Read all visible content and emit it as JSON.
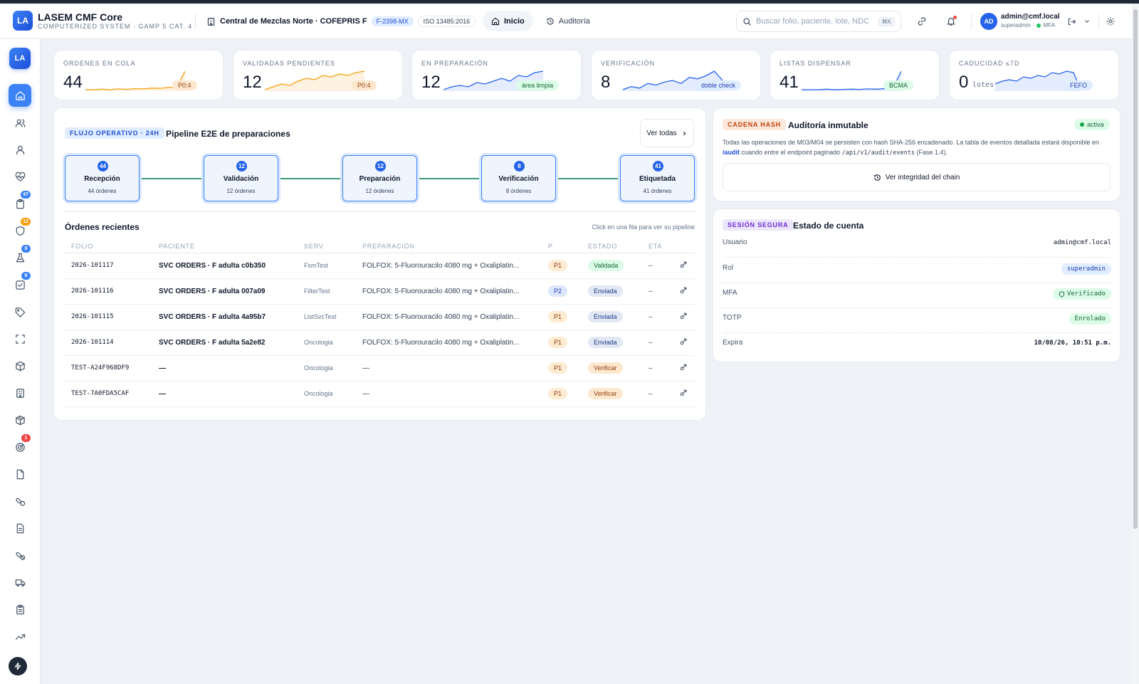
{
  "header": {
    "logo_text": "LA",
    "title": "LASEM CMF Core",
    "subtitle": "COMPUTERIZED SYSTEM · GAMP 5 CAT. 4",
    "facility": "Central de Mezclas Norte · COFEPRIS F",
    "facility_code": "F-2398-MX",
    "iso": "ISO 13485:2016",
    "tabs": [
      {
        "label": "Inicio",
        "icon": "home-icon",
        "active": true
      },
      {
        "label": "Auditoría",
        "icon": "history-icon",
        "active": false
      }
    ],
    "search_placeholder": "Buscar folio, paciente, lote, NDC",
    "search_shortcut": "⌘K",
    "user": {
      "initials": "AD",
      "name": "admin@cmf.local",
      "role": "superadmin",
      "mfa": "MFA"
    }
  },
  "sidebar": {
    "logo_text": "LA",
    "items": [
      {
        "icon": "home-icon",
        "active": true,
        "badge": ""
      },
      {
        "icon": "users-icon",
        "badge": ""
      },
      {
        "icon": "user-icon",
        "badge": ""
      },
      {
        "icon": "heart-pulse-icon",
        "badge": ""
      },
      {
        "icon": "clipboard-icon",
        "badge": "47",
        "badge_color": "#3b82f6"
      },
      {
        "icon": "shield-icon",
        "badge": "12",
        "badge_color": "#f59e0b"
      },
      {
        "icon": "flask-icon",
        "badge": "9",
        "badge_color": "#3b82f6"
      },
      {
        "icon": "check-square-icon",
        "badge": "6",
        "badge_color": "#3b82f6"
      },
      {
        "icon": "tag-icon",
        "badge": ""
      },
      {
        "icon": "scan-icon",
        "badge": ""
      },
      {
        "icon": "box-icon",
        "badge": ""
      },
      {
        "icon": "building-icon",
        "badge": ""
      },
      {
        "icon": "package-icon",
        "badge": ""
      },
      {
        "icon": "radar-icon",
        "badge": "1",
        "badge_color": "#ef4444"
      },
      {
        "icon": "file-icon",
        "badge": ""
      },
      {
        "icon": "pills-icon",
        "badge": ""
      },
      {
        "icon": "document-icon",
        "badge": ""
      },
      {
        "icon": "capsule-icon",
        "badge": ""
      },
      {
        "icon": "truck-icon",
        "badge": ""
      },
      {
        "icon": "clipboard-list-icon",
        "badge": ""
      },
      {
        "icon": "trending-icon",
        "badge": ""
      }
    ]
  },
  "kpis": [
    {
      "label": "ÓRDENES EN COLA",
      "value": "44",
      "unit": "",
      "chip": "P0:4",
      "chip_style": "orange",
      "spark": [
        2,
        2,
        2.2,
        2,
        2.3,
        2.1,
        2.4,
        2.3,
        2.6,
        2.5,
        2.8,
        3,
        9
      ],
      "color": "#f59e0b"
    },
    {
      "label": "VALIDADAS PENDIENTES",
      "value": "12",
      "unit": "",
      "chip": "P0:4",
      "chip_style": "orange",
      "spark": [
        1,
        2,
        3,
        2.5,
        4,
        5,
        4.5,
        6,
        5.5,
        6.5,
        6,
        7,
        7.5
      ],
      "color": "#f59e0b"
    },
    {
      "label": "EN PREPARACIÓN",
      "value": "12",
      "unit": "",
      "chip": "área limpia",
      "chip_style": "green",
      "spark": [
        1,
        2,
        2.5,
        2,
        3.5,
        3,
        4,
        5,
        4,
        6,
        5.5,
        7,
        7.5
      ],
      "color": "#2563eb"
    },
    {
      "label": "VERIFICACIÓN",
      "value": "8",
      "unit": "",
      "chip": "doble check",
      "chip_style": "blue",
      "spark": [
        1,
        2,
        1.5,
        3,
        2.5,
        3.5,
        4,
        3,
        5,
        4.5,
        5.5,
        7,
        4
      ],
      "color": "#2563eb"
    },
    {
      "label": "LISTAS DISPENSAR",
      "value": "41",
      "unit": "",
      "chip": "BCMA",
      "chip_style": "green",
      "spark": [
        1,
        1,
        1,
        1.2,
        1,
        1.1,
        1.2,
        1.1,
        1.3,
        1.2,
        1.4,
        1.6,
        8
      ],
      "color": "#2563eb"
    },
    {
      "label": "CADUCIDAD ≤7D",
      "value": "0",
      "unit": "lotes",
      "chip": "FEFO",
      "chip_style": "blue",
      "spark": [
        3,
        4,
        4.5,
        4,
        5.5,
        5,
        6,
        5.5,
        7,
        6.5,
        7.5,
        7,
        1
      ],
      "color": "#2563eb"
    }
  ],
  "pipeline": {
    "tag": "FLUJO OPERATIVO · 24H",
    "title": "Pipeline E2E de preparaciones",
    "view_all": "Ver todas",
    "steps": [
      {
        "count": "44",
        "name": "Recepción",
        "sub": "44 órdenes"
      },
      {
        "count": "12",
        "name": "Validación",
        "sub": "12 órdenes"
      },
      {
        "count": "12",
        "name": "Preparación",
        "sub": "12 órdenes"
      },
      {
        "count": "8",
        "name": "Verificación",
        "sub": "8 órdenes"
      },
      {
        "count": "41",
        "name": "Etiquetada",
        "sub": "41 órdenes"
      }
    ]
  },
  "orders": {
    "title": "Órdenes recientes",
    "hint": "Click en una fila para ver su pipeline",
    "columns": [
      "FOLIO",
      "PACIENTE",
      "SERV.",
      "PREPARACIÓN",
      "P",
      "ESTADO",
      "ETA"
    ],
    "rows": [
      {
        "folio": "2026-101117",
        "paciente": "SVC ORDERS · F adulta c0b350",
        "serv": "FsmTest",
        "prep": "FOLFOX: 5-Fluorouracilo 4080 mg + Oxaliplatin...",
        "p": "P1",
        "estado": "Validada",
        "eta": "–"
      },
      {
        "folio": "2026-101116",
        "paciente": "SVC ORDERS · F adulta 007a09",
        "serv": "FilterTest",
        "prep": "FOLFOX: 5-Fluorouracilo 4080 mg + Oxaliplatin...",
        "p": "P2",
        "estado": "Enviada",
        "eta": "–"
      },
      {
        "folio": "2026-101115",
        "paciente": "SVC ORDERS · F adulta 4a95b7",
        "serv": "ListSvcTest",
        "prep": "FOLFOX: 5-Fluorouracilo 4080 mg + Oxaliplatin...",
        "p": "P1",
        "estado": "Enviada",
        "eta": "–"
      },
      {
        "folio": "2026-101114",
        "paciente": "SVC ORDERS · F adulta 5a2e82",
        "serv": "Oncologia",
        "prep": "FOLFOX: 5-Fluorouracilo 4080 mg + Oxaliplatin...",
        "p": "P1",
        "estado": "Enviada",
        "eta": "–"
      },
      {
        "folio": "TEST-A24F968DF9",
        "paciente": "—",
        "serv": "Oncologia",
        "prep": "—",
        "p": "P1",
        "estado": "Verificar",
        "eta": "–"
      },
      {
        "folio": "TEST-7A0FDA5CAF",
        "paciente": "—",
        "serv": "Oncologia",
        "prep": "—",
        "p": "P1",
        "estado": "Verificar",
        "eta": "–"
      }
    ]
  },
  "audit": {
    "tag": "CADENA HASH",
    "title": "Auditoría inmutable",
    "status": "activa",
    "desc_1": "Todas las operaciones de M03/M04 se persisten con hash SHA-256 encadenado. La tabla de eventos detallada estará disponible en",
    "desc_link": "/audit",
    "desc_2": "cuando entre el endpoint paginado",
    "desc_code": "/api/v1/audit/events",
    "desc_3": "(Fase 1.4).",
    "button": "Ver integridad del chain"
  },
  "session": {
    "tag": "SESIÓN SEGURA",
    "title": "Estado de cuenta",
    "rows": [
      {
        "label": "Usuario",
        "value": "admin@cmf.local",
        "style": "plain"
      },
      {
        "label": "Rol",
        "value": "superadmin",
        "style": "blue"
      },
      {
        "label": "MFA",
        "value": "Verificado",
        "style": "green-icon"
      },
      {
        "label": "TOTP",
        "value": "Enrolado",
        "style": "green"
      },
      {
        "label": "Expira",
        "value": "10/08/26, 10:51 p.m.",
        "style": "plain-bold"
      }
    ]
  }
}
